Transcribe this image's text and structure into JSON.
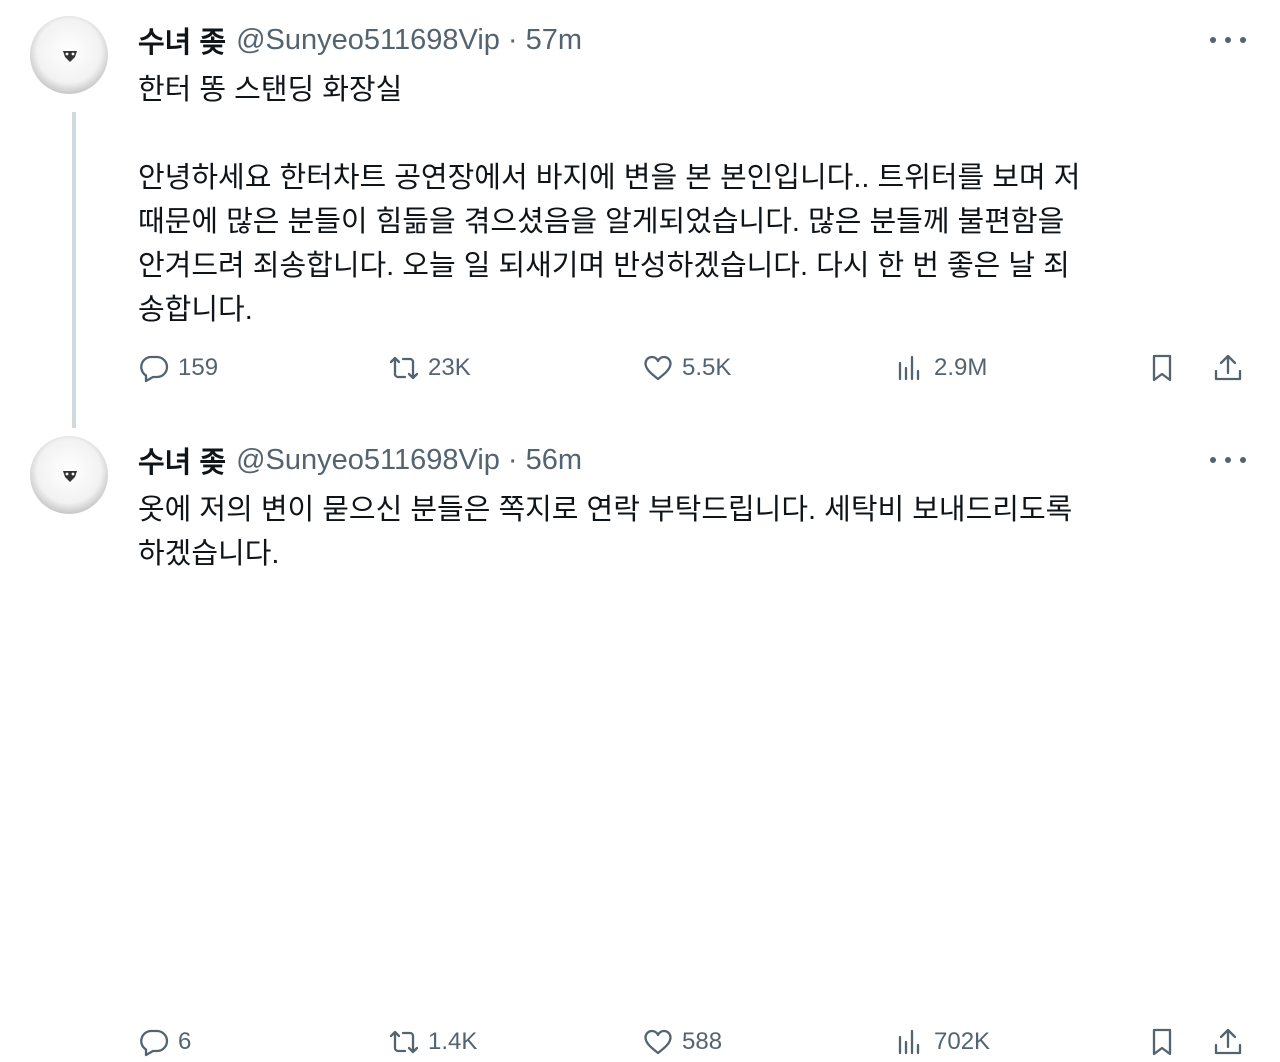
{
  "tweets": [
    {
      "name": "수녀 좆",
      "handle": "@Sunyeo511698Vip",
      "separator": "·",
      "time": "57m",
      "text": "한터 똥 스탠딩 화장실\n\n안녕하세요 한터차트 공연장에서 바지에 변을 본 본인입니다.. 트위터를 보며 저\n때문에 많은 분들이 힘듦을 겪으셨음을 알게되었습니다. 많은 분들께 불편함을\n안겨드려 죄송합니다. 오늘 일 되새기며 반성하겠습니다. 다시 한 번 좋은 날 죄\n송합니다.",
      "replies": "159",
      "retweets": "23K",
      "likes": "5.5K",
      "views": "2.9M"
    },
    {
      "name": "수녀 좆",
      "handle": "@Sunyeo511698Vip",
      "separator": "·",
      "time": "56m",
      "text": "옷에 저의 변이 묻으신 분들은 쪽지로 연락 부탁드립니다. 세탁비 보내드리도록\n하겠습니다.",
      "replies": "6",
      "retweets": "1.4K",
      "likes": "588",
      "views": "702K"
    }
  ],
  "icons": {
    "reply": "reply-icon",
    "retweet": "retweet-icon",
    "like": "heart-icon",
    "views": "views-icon",
    "bookmark": "bookmark-icon",
    "share": "share-icon",
    "more": "more-icon"
  },
  "colors": {
    "text": "#0f1419",
    "secondary": "#536471",
    "thread_line": "#cfd9de",
    "background": "#ffffff"
  }
}
